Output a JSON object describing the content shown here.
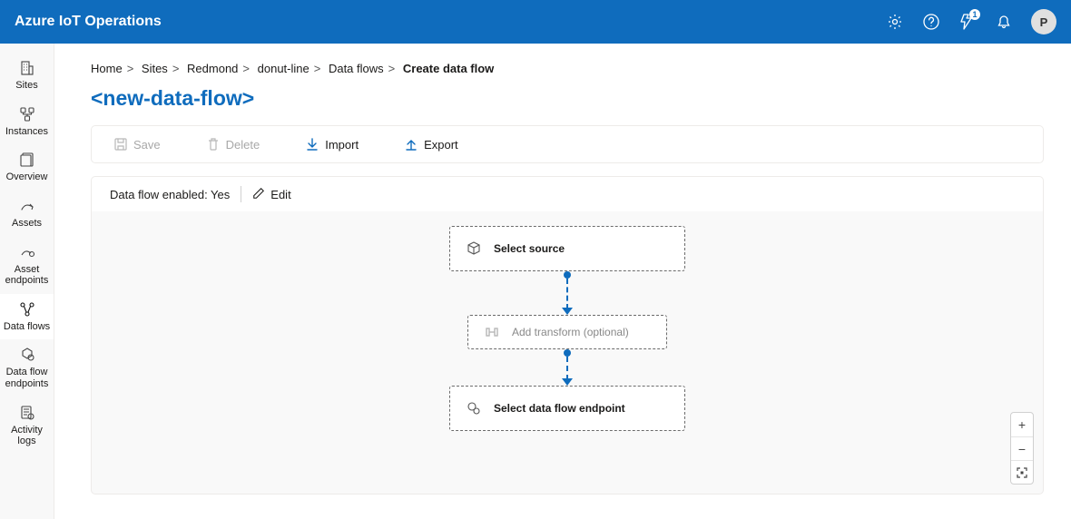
{
  "header": {
    "title": "Azure IoT Operations",
    "avatar_initial": "P",
    "notif_badge": "1"
  },
  "sidebar": {
    "items": [
      {
        "label": "Sites"
      },
      {
        "label": "Instances"
      },
      {
        "label": "Overview"
      },
      {
        "label": "Assets"
      },
      {
        "label": "Asset endpoints"
      },
      {
        "label": "Data flows"
      },
      {
        "label": "Data flow endpoints"
      },
      {
        "label": "Activity logs"
      }
    ]
  },
  "breadcrumb": {
    "items": [
      "Home",
      "Sites",
      "Redmond",
      "donut-line",
      "Data flows"
    ],
    "current": "Create data flow"
  },
  "page_title": "<new-data-flow>",
  "toolbar": {
    "save": "Save",
    "delete": "Delete",
    "import": "Import",
    "export": "Export"
  },
  "status": {
    "text": "Data flow enabled: Yes",
    "edit": "Edit"
  },
  "flow_nodes": {
    "source": "Select source",
    "transform": "Add transform (optional)",
    "endpoint": "Select data flow endpoint"
  },
  "zoom": {
    "in": "+",
    "out": "−"
  }
}
